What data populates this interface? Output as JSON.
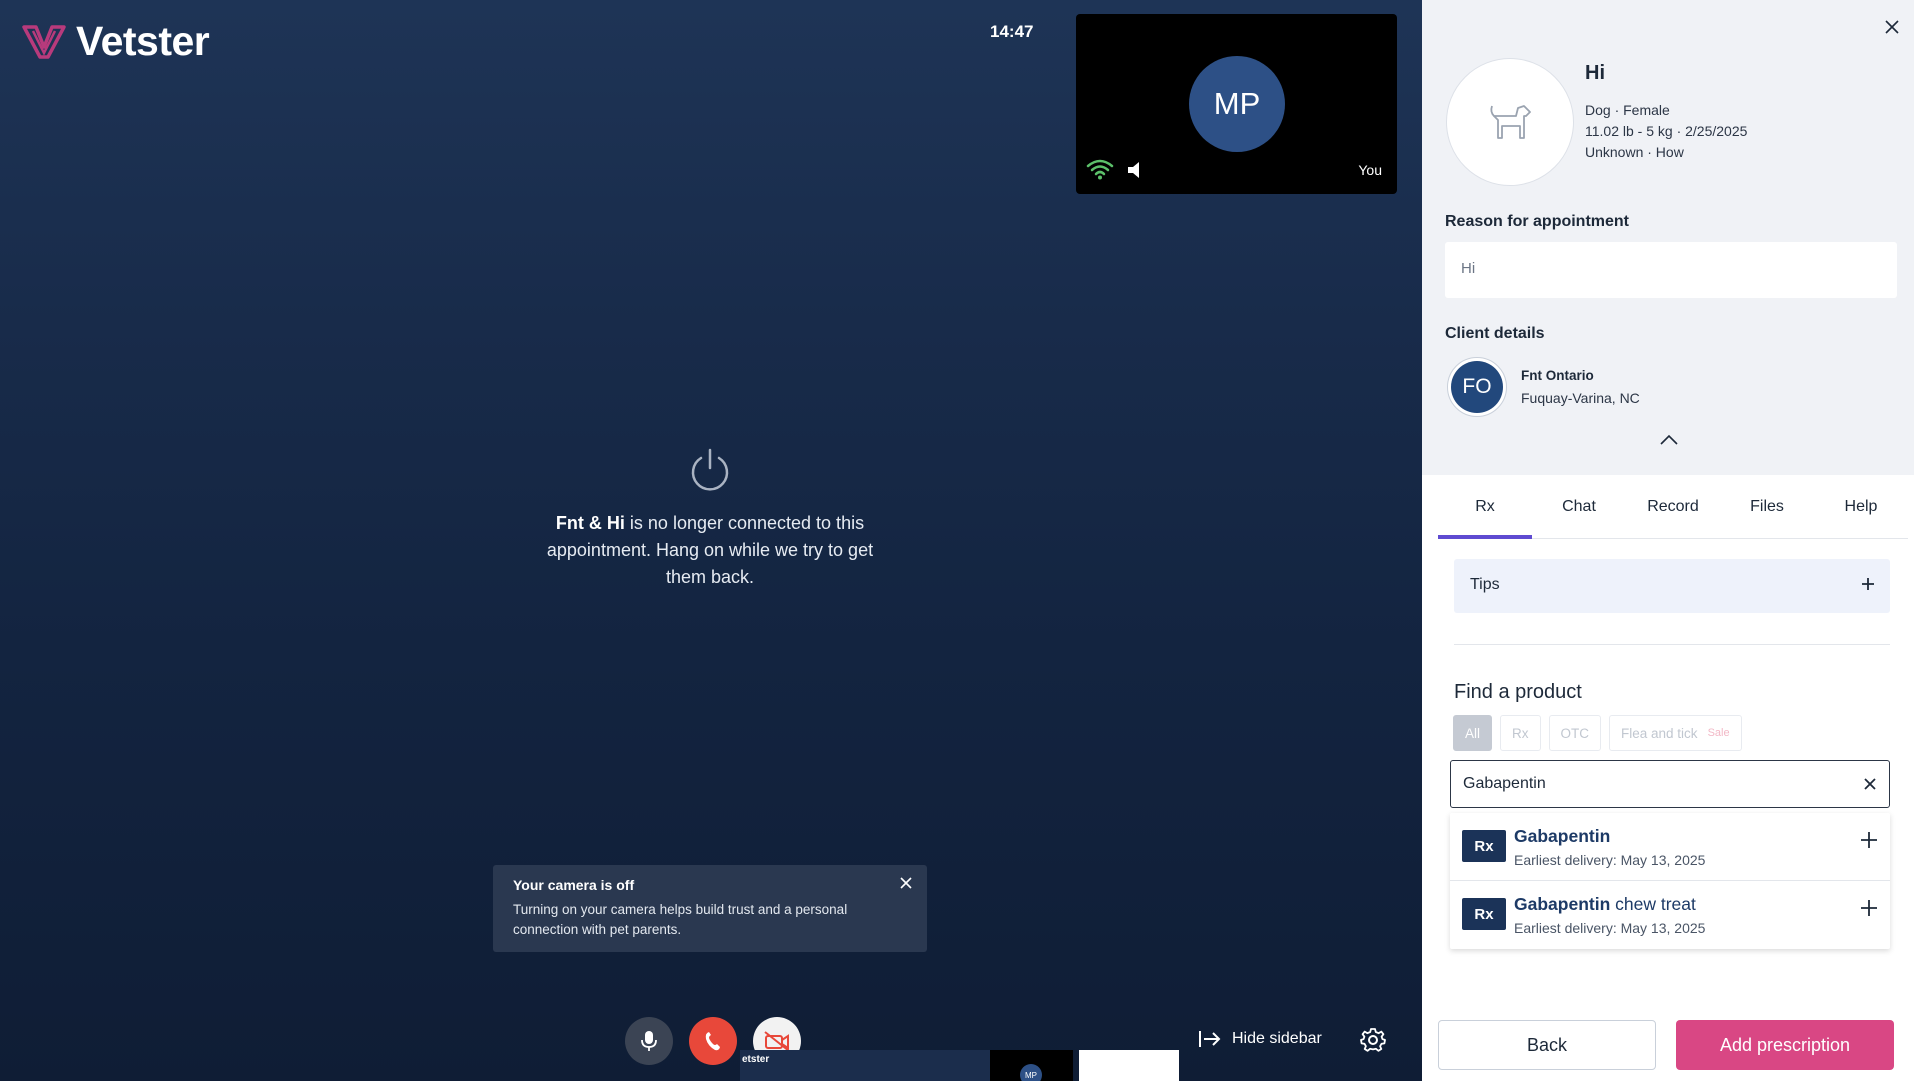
{
  "brand": {
    "name": "Vetster",
    "color": "#b83a7c"
  },
  "call": {
    "clock": "14:47",
    "self_view": {
      "initials": "MP",
      "label": "You"
    },
    "status": {
      "names": "Fnt & Hi",
      "message": " is no longer connected to this appointment. Hang on while we try to get them back."
    },
    "toast": {
      "title": "Your camera is off",
      "body": "Turning on your camera helps build trust and a personal connection with pet parents."
    },
    "controls": {
      "hide_sidebar": "Hide sidebar"
    },
    "thumb": {
      "label": "etster",
      "initials": "MP"
    }
  },
  "pet": {
    "name": "Hi",
    "species_sex": "Dog · Female",
    "weight_dob": "11.02 lb - 5 kg · 2/25/2025",
    "breed": "Unknown · How"
  },
  "reason": {
    "label": "Reason for appointment",
    "value": "Hi"
  },
  "client": {
    "label": "Client details",
    "initials": "FO",
    "name": "Fnt Ontario",
    "location": "Fuquay-Varina, NC"
  },
  "tabs": [
    {
      "label": "Rx",
      "active": true
    },
    {
      "label": "Chat",
      "active": false
    },
    {
      "label": "Record",
      "active": false
    },
    {
      "label": "Files",
      "active": false
    },
    {
      "label": "Help",
      "active": false
    }
  ],
  "rx_panel": {
    "tips_label": "Tips",
    "find_title": "Find a product",
    "filters": {
      "all": "All",
      "rx": "Rx",
      "otc": "OTC",
      "flea": "Flea and tick",
      "sale": "Sale"
    },
    "search_value": "Gabapentin",
    "results": [
      {
        "badge": "Rx",
        "name": "Gabapentin",
        "suffix": "",
        "delivery": "Earliest delivery: May 13, 2025"
      },
      {
        "badge": "Rx",
        "name": "Gabapentin",
        "suffix": " chew treat",
        "delivery": "Earliest delivery: May 13, 2025"
      }
    ],
    "back_label": "Back",
    "add_label": "Add prescription"
  },
  "colors": {
    "accent_tab": "#5f4bd1",
    "primary_button": "#d94784",
    "rx_badge": "#1b3358",
    "hangup": "#e8483a"
  }
}
